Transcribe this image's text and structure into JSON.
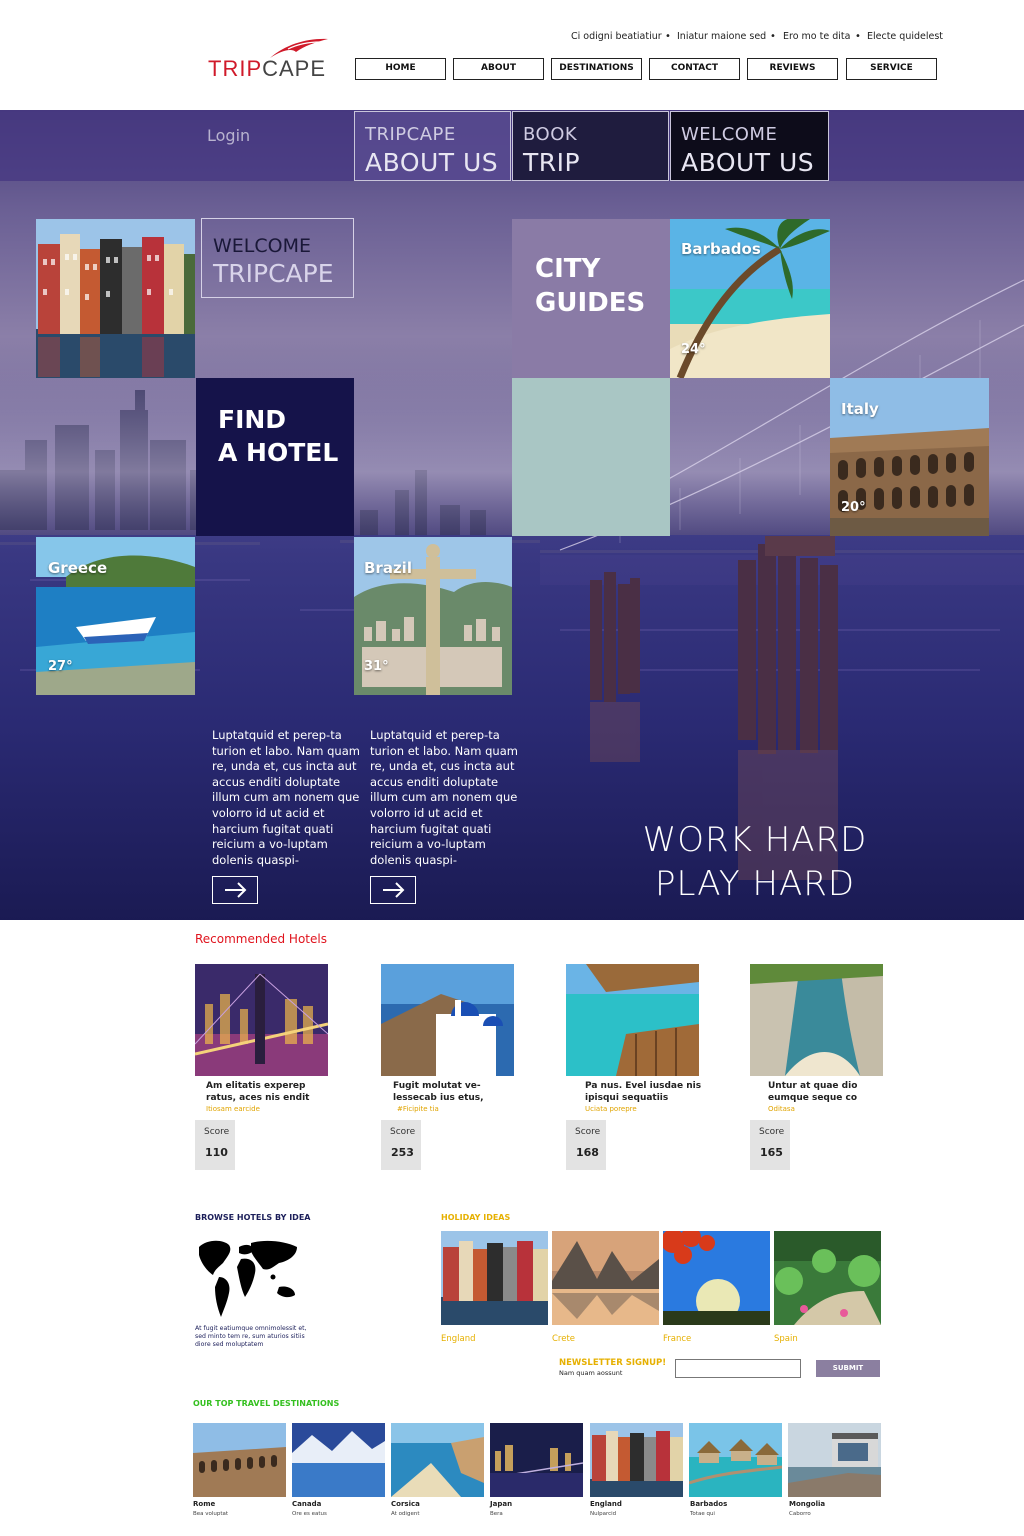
{
  "brand": {
    "name_part1": "TRIP",
    "name_part2": "CAPE",
    "accent": "#d01a2a"
  },
  "top_links": [
    "Ci odigni beatiatiur",
    "Iniatur maione sed",
    "Ero mo te dita",
    "Electe quidelest"
  ],
  "nav": [
    "HOME",
    "ABOUT",
    "DESTINATIONS",
    "CONTACT",
    "REVIEWS",
    "SERVICE"
  ],
  "login_label": "Login",
  "tabs": [
    {
      "line1": "TRIPCAPE",
      "line2": "ABOUT US"
    },
    {
      "line1": "BOOK",
      "line2": "TRIP"
    },
    {
      "line1": "WELCOME",
      "line2": "ABOUT US"
    }
  ],
  "tiles": {
    "welcome": {
      "line1": "WELCOME",
      "line2": "TRIPCAPE"
    },
    "city_guides": {
      "line1": "CITY",
      "line2": "GUIDES"
    },
    "find_hotel": {
      "line1": "FIND",
      "line2": "A HOTEL"
    },
    "barbados": {
      "name": "Barbados",
      "temp": "24°"
    },
    "italy": {
      "name": "Italy",
      "temp": "20°"
    },
    "greece": {
      "name": "Greece",
      "temp": "27°"
    },
    "brazil": {
      "name": "Brazil",
      "temp": "31°"
    }
  },
  "paragraphs": [
    "Luptatquid et perep-ta turion et labo. Nam quam re, unda et, cus incta aut accus enditi doluptate illum cum am nonem que volorro id ut acid et harcium fugitat quati reicium a vo-luptam dolenis quaspi-",
    "Luptatquid et perep-ta turion et labo. Nam quam re, unda et, cus incta aut accus enditi doluptate illum cum am nonem que volorro id ut acid et harcium fugitat quati reicium a vo-luptam dolenis quaspi-"
  ],
  "slogan": {
    "line1": "WORK HARD",
    "line2": "PLAY HARD"
  },
  "recommended": {
    "title": "Recommended Hotels",
    "score_label": "Score",
    "items": [
      {
        "name": "Am elitatis experep ratus, aces nis endit",
        "tag": "Itiosam earcide",
        "score": "110"
      },
      {
        "name": "Fugit molutat ve-lessecab ius etus,",
        "tag": "#Ficipite tia",
        "score": "253"
      },
      {
        "name": "Pa nus. Evel iusdae nis ipisqui sequatiis",
        "tag": "Uciata porepre",
        "score": "168"
      },
      {
        "name": "Untur at quae dio eumque seque co",
        "tag": "Oditasa",
        "score": "165"
      }
    ]
  },
  "browse": {
    "title": "BROWSE HOTELS BY IDEA",
    "text": "At fugit eatiumque omnimolessit et, sed minto tem re, sum aturios sitiis diore sed moluptatem"
  },
  "holiday": {
    "title": "HOLIDAY IDEAS",
    "items": [
      "England",
      "Crete",
      "France",
      "Spain"
    ]
  },
  "newsletter": {
    "title": "NEWSLETTER SIGNUP!",
    "subtitle": "Nam quam aossunt",
    "input_value": "",
    "submit": "SUBMIT"
  },
  "top_destinations": {
    "title": "OUR TOP TRAVEL DESTINATIONS",
    "items": [
      {
        "name": "Rome",
        "sub": "Bea voluptat"
      },
      {
        "name": "Canada",
        "sub": "Ore es eatus"
      },
      {
        "name": "Corsica",
        "sub": "At odigent"
      },
      {
        "name": "Japan",
        "sub": "Bera"
      },
      {
        "name": "England",
        "sub": "Nulparcid"
      },
      {
        "name": "Barbados",
        "sub": "Totae qui"
      },
      {
        "name": "Mongolia",
        "sub": "Caborro"
      }
    ]
  },
  "colors": {
    "hero_purple": "#4a3f7a",
    "find_hotel_bg": "#15134a",
    "city_guides_bg": "#8a7ba6",
    "mint_tile": "#a9c6c4",
    "holiday_gold": "#e6b000",
    "top_green": "#35c020"
  }
}
